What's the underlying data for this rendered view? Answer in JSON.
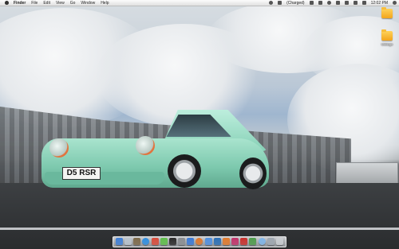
{
  "menubar": {
    "app_name": "Finder",
    "menus": [
      "File",
      "Edit",
      "View",
      "Go",
      "Window",
      "Help"
    ],
    "battery_status": "(Charged)",
    "clock": "12:02 PM"
  },
  "desktop": {
    "icons": [
      {
        "label": "",
        "icon": "folder-icon"
      },
      {
        "label": "Ukklogo",
        "icon": "folder-icon"
      }
    ]
  },
  "wallpaper": {
    "license_plate": "D5 RSR"
  },
  "colors": {
    "car_body": "#7cc8ad",
    "headlight_ring": "#e1743e",
    "menubar": "#f0f0f0"
  },
  "dock": {
    "items": [
      {
        "name": "finder-icon",
        "color": "#3f7fd6"
      },
      {
        "name": "mail-icon",
        "color": "#b9c3cc"
      },
      {
        "name": "contacts-icon",
        "color": "#7d6a4a"
      },
      {
        "name": "safari-icon",
        "color": "#2f8ee0"
      },
      {
        "name": "ical-icon",
        "color": "#d94b3b"
      },
      {
        "name": "messages-icon",
        "color": "#5fbf4a"
      },
      {
        "name": "terminal-icon",
        "color": "#2a2a2a"
      },
      {
        "name": "system-preferences-icon",
        "color": "#8a8d91"
      },
      {
        "name": "itunes-icon",
        "color": "#3b79d6"
      },
      {
        "name": "firefox-icon",
        "color": "#e0772b"
      },
      {
        "name": "app-store-icon",
        "color": "#4f8fdf"
      },
      {
        "name": "photoshop-icon",
        "color": "#2b6fb5"
      },
      {
        "name": "illustrator-icon",
        "color": "#e07a2c"
      },
      {
        "name": "indesign-icon",
        "color": "#c2336a"
      },
      {
        "name": "flash-icon",
        "color": "#c9302c"
      },
      {
        "name": "dreamweaver-icon",
        "color": "#4e9c4b"
      },
      {
        "name": "preview-icon",
        "color": "#7fb5e8"
      },
      {
        "name": "downloads-stack-icon",
        "color": "#9ea7b0"
      },
      {
        "name": "trash-icon",
        "color": "#c8ccd0"
      }
    ]
  }
}
